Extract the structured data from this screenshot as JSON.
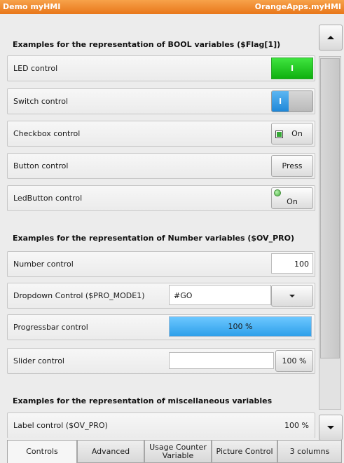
{
  "app": {
    "title_left": "Demo myHMI",
    "title_right": "OrangeApps.myHMI"
  },
  "sections": [
    "Examples for the representation of BOOL variables ($Flag[1])",
    "Examples for the representation of Number variables ($OV_PRO)",
    "Examples for the representation of miscellaneous variables"
  ],
  "bool_controls": {
    "led": {
      "label": "LED control",
      "value": "I",
      "color": "#22c522"
    },
    "switch": {
      "label": "Switch control",
      "value": "I"
    },
    "checkbox": {
      "label": "Checkbox control",
      "value": "On"
    },
    "button": {
      "label": "Button control",
      "value": "Press"
    },
    "ledbutton": {
      "label": "LedButton control",
      "value": "On"
    }
  },
  "number_controls": {
    "number": {
      "label": "Number control",
      "value": "100"
    },
    "dropdown": {
      "label": "Dropdown Control ($PRO_MODE1)",
      "value": "#GO"
    },
    "progressbar": {
      "label": "Progressbar control",
      "value_text": "100 %",
      "fraction": 1.0
    },
    "slider": {
      "label": "Slider control",
      "value": "100 %"
    }
  },
  "misc_controls": {
    "label": {
      "label": "Label control ($OV_PRO)",
      "value": "100 %"
    }
  },
  "tabs": [
    {
      "label": "Controls"
    },
    {
      "label": "Advanced"
    },
    {
      "label": "Usage Counter Variable"
    },
    {
      "label": "Picture Control"
    },
    {
      "label": "3 columns"
    }
  ]
}
